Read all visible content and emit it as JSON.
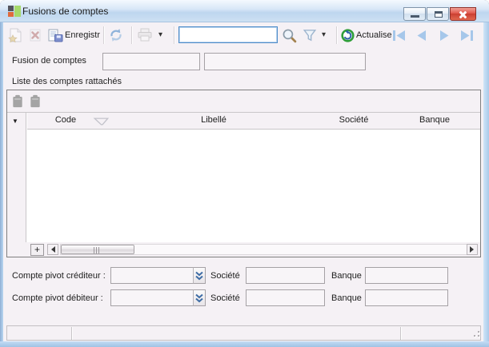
{
  "window": {
    "title": "Fusions de comptes"
  },
  "toolbar": {
    "save_label": "Enregistr",
    "actualise_label": "Actualise",
    "search": {
      "value": ""
    }
  },
  "form": {
    "fusion_label": "Fusion de comptes",
    "fusion_code_value": "",
    "fusion_libelle_value": "",
    "list_label": "Liste des comptes rattachés"
  },
  "table": {
    "headers": [
      "Code",
      "Libellé",
      "Société",
      "Banque"
    ],
    "rows": [],
    "add_row_label": "+"
  },
  "pivot": {
    "crediteur_label": "Compte pivot créditeur :",
    "debiteur_label": "Compte pivot débiteur :",
    "societe_label": "Société",
    "banque_label": "Banque",
    "crediteur": {
      "compte": "",
      "societe": "",
      "banque": ""
    },
    "debiteur": {
      "compte": "",
      "societe": "",
      "banque": ""
    }
  },
  "statusbar": {
    "panel1": "",
    "panel2": "",
    "panel3": ""
  },
  "icons": {
    "dropdown_arrow": "▾",
    "row_marker": "▼"
  },
  "colors": {
    "dialog_bg": "#f5f1f5",
    "titlebar_blue": "#bed6ef",
    "close_red": "#d34a3c",
    "focus_border": "#4e8cc9",
    "nav_arrow_blue": "#a6c7ea",
    "refresh_blue": "#8fb3da",
    "actualise_green": "#2e9e38",
    "actualise_swirl_blue": "#2f62a8"
  }
}
